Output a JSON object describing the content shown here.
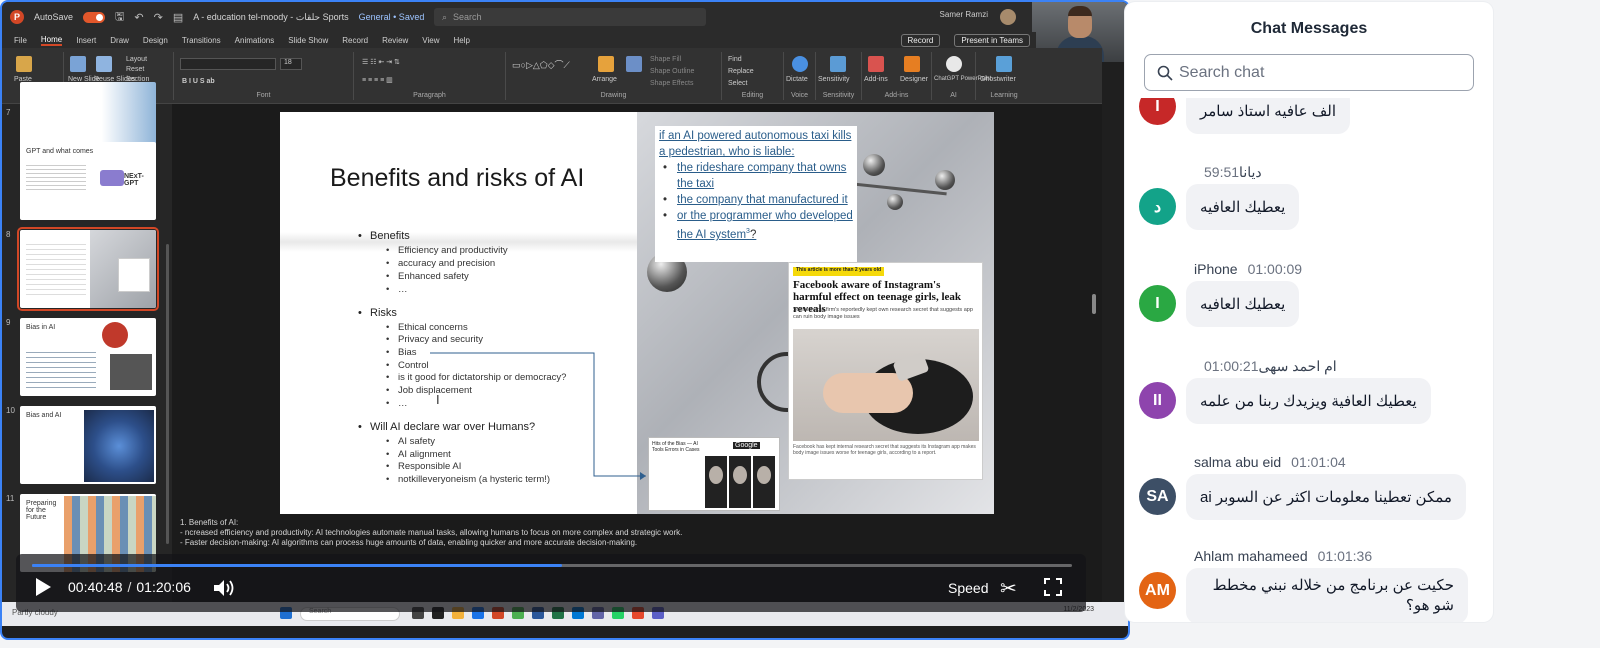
{
  "powerpoint": {
    "app_badge": "P",
    "autosave_label": "AutoSave",
    "doc_title": "A - education tel-moody - حلقات Sports",
    "sensitivity": "General • Saved",
    "search_placeholder": "Search",
    "user_name": "Samer Ramzi",
    "menu": [
      "File",
      "Home",
      "Insert",
      "Draw",
      "Design",
      "Transitions",
      "Animations",
      "Slide Show",
      "Record",
      "Review",
      "View",
      "Help"
    ],
    "active_menu": "Home",
    "record_button": "Record",
    "present_button": "Present in Teams",
    "ribbon_groups": [
      "Clipboard",
      "Slides",
      "Font",
      "Paragraph",
      "Drawing",
      "Editing",
      "Voice",
      "Sensitivity",
      "Add-ins",
      "AI",
      "Learning"
    ],
    "ribbon_labels": {
      "paste": "Paste",
      "new_slide": "New Slide",
      "reuse": "Reuse Slides",
      "layout": "Layout",
      "reset": "Reset",
      "section": "Section",
      "arrange": "Arrange",
      "quick_styles": "Quick Styles",
      "shape_fill": "Shape Fill",
      "shape_outline": "Shape Outline",
      "shape_effects": "Shape Effects",
      "find": "Find",
      "replace": "Replace",
      "select": "Select",
      "dictate": "Dictate",
      "sensitivity": "Sensitivity",
      "addins": "Add-ins",
      "designer": "Designer",
      "chatgpt": "ChatGPT PowerPoint",
      "ghostwriter": "Ghostwriter",
      "font_size": "18"
    }
  },
  "thumbnails": [
    {
      "num": "7",
      "title": ""
    },
    {
      "num": "",
      "title": "GPT and what comes"
    },
    {
      "num": "8",
      "title": ""
    },
    {
      "num": "9",
      "title": "Bias in AI"
    },
    {
      "num": "10",
      "title": "Bias and AI"
    },
    {
      "num": "11",
      "title": "Preparing for the Future"
    }
  ],
  "thumb_brand": "NExT-GPT",
  "slide": {
    "title": "Benefits and risks of AI",
    "benefits_heading": "Benefits",
    "benefits": [
      "Efficiency and productivity",
      "accuracy and precision",
      "Enhanced safety",
      "…"
    ],
    "risks_heading": "Risks",
    "risks": [
      "Ethical concerns",
      "Privacy and security",
      "Bias",
      "Control",
      "is it good for dictatorship or democracy?",
      "Job displacement",
      "…"
    ],
    "war_heading": "Will AI declare war over Humans?",
    "war_items": [
      "AI safety",
      "AI alignment",
      "Responsible AI",
      "notkilleveryoneism (a hysteric term!)"
    ],
    "callout_question": "if an AI powered autonomous taxi kills a pedestrian, who is liable:",
    "callout_items": [
      "the rideshare company that owns the taxi",
      "the company that manufactured it",
      "or the programmer who developed the AI system"
    ],
    "callout_suffix": "?",
    "callout_sup": "3",
    "news_tag": "This article is more than 2 years old",
    "news_headline": "Facebook aware of Instagram's harmful effect on teenage girls, leak reveals",
    "news_sub": "Social media firm's reportedly kept own research secret that suggests app can ruin body image issues",
    "news_caption": "Facebook has kept internal research secret that suggests its Instagram app makes body image issues worse for teenage girls, according to a report.",
    "mini_text": "Hits of the Bias — AI Tools Errors in Cases",
    "mini_brand": "Google"
  },
  "notes": [
    "1. Benefits of AI:",
    "- ncreased efficiency and productivity: AI technologies automate manual tasks, allowing humans to focus on more complex and strategic work.",
    "- Faster decision-making: AI algorithms can process huge amounts of data, enabling quicker and more accurate decision-making."
  ],
  "taskbar": {
    "weather": "Partly cloudy",
    "search": "Search",
    "time": "",
    "date": "11/2/2023"
  },
  "player": {
    "current_time": "00:40:48",
    "separator": "/",
    "total_time": "01:20:06",
    "progress": 0.51,
    "speed_label": "Speed"
  },
  "chat": {
    "title": "Chat Messages",
    "search_placeholder": "Search chat",
    "messages": [
      {
        "initials": "I",
        "color": "#c62828",
        "name": "",
        "time": "",
        "text": "الف عافيه استاذ سامر"
      },
      {
        "initials": "د",
        "color": "#13a389",
        "name": "ديانا",
        "time": "59:51",
        "text": "يعطيك العافيه"
      },
      {
        "initials": "I",
        "color": "#2aa843",
        "name": "iPhone",
        "time": "01:00:09",
        "text": "يعطيك العافيه"
      },
      {
        "initials": "II",
        "color": "#8e44ad",
        "name": "ام احمد سهى",
        "time": "01:00:21",
        "text": "يعطيك العافية ويزيدك  ربنا من علمه"
      },
      {
        "initials": "SA",
        "color": "#3d4f66",
        "name": "salma abu eid",
        "time": "01:01:04",
        "text": "ممكن تعطينا معلومات اكثر عن السوبر ai"
      },
      {
        "initials": "AM",
        "color": "#e36414",
        "name": "Ahlam mahameed",
        "time": "01:01:36",
        "text": "حكيت عن برنامج من خلاله نبني مخطط شو هو؟"
      }
    ]
  }
}
